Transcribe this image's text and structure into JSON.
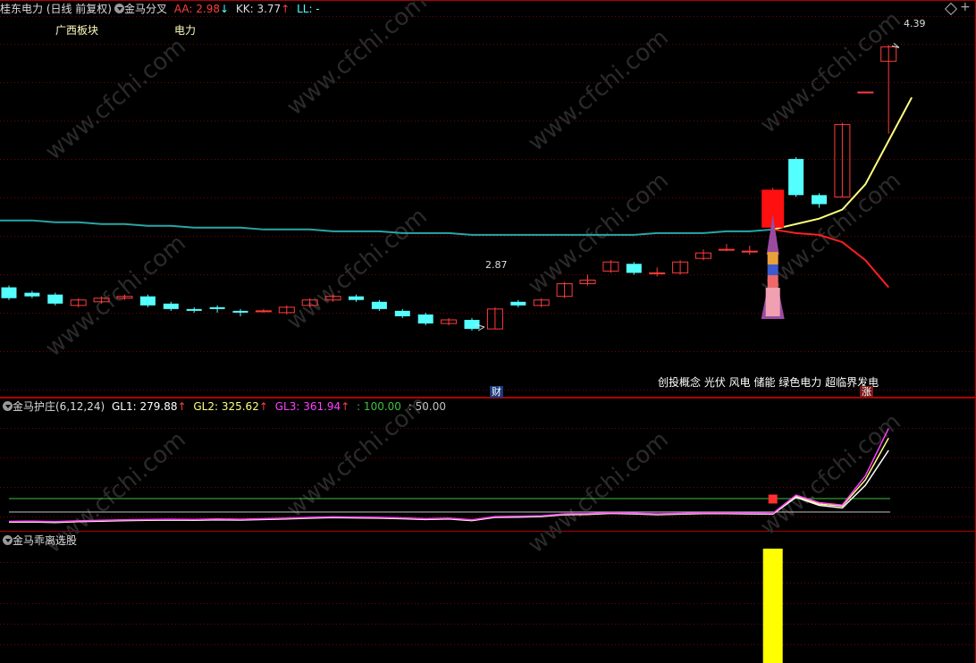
{
  "header": {
    "stock_title": "桂东电力 (日线 前复权)",
    "indicator_name": "金马分叉",
    "aa_label": "AA: 2.98",
    "aa_arrow": "↓",
    "kk_label": "KK: 3.77",
    "kk_arrow": "↑",
    "ll_label": "LL: -"
  },
  "sector_tags": [
    "广西板块",
    "电力"
  ],
  "main_chart": {
    "high_label": "4.39",
    "low_label": "2.87",
    "concepts_text": "创投概念 光伏 风电 储能 绿色电力 超临界发电",
    "fin_badge": "财",
    "zhang_badge": "涨"
  },
  "panel2": {
    "title": "金马护庄(6,12,24)",
    "gl1_label": "GL1: 279.88",
    "gl1_arrow": "↑",
    "gl2_label": "GL2: 325.62",
    "gl2_arrow": "↑",
    "gl3_label": "GL3: 361.94",
    "gl3_arrow": "↑",
    "ref1_label": ": 100.00",
    "ref2_label": ": 50.00"
  },
  "panel3": {
    "title": "金马乖离选股"
  },
  "watermark": "www.cfchi.com",
  "colors": {
    "background": "#000000",
    "grid": "#7a0000",
    "up": "#ff3c3c",
    "down": "#54ffff",
    "ma_long": "#2aa6a6",
    "line_yellow": "#ffff80",
    "line_red": "#ff2020",
    "gl1": "#ffffff",
    "gl2": "#ffff80",
    "gl3": "#ff40ff",
    "ref100": "#40c040",
    "ref50": "#c0c0c0",
    "bar_yellow": "#ffff00"
  },
  "chart_data": [
    {
      "type": "candlestick",
      "title": "桂东电力 (日线 前复权)",
      "candles": [
        {
          "o": 3.05,
          "c": 2.99,
          "h": 3.06,
          "l": 2.98
        },
        {
          "o": 3.02,
          "c": 3.0,
          "h": 3.03,
          "l": 2.99
        },
        {
          "o": 3.01,
          "c": 2.96,
          "h": 3.02,
          "l": 2.95
        },
        {
          "o": 2.95,
          "c": 2.98,
          "h": 2.99,
          "l": 2.94
        },
        {
          "o": 2.97,
          "c": 2.99,
          "h": 3.0,
          "l": 2.96
        },
        {
          "o": 2.99,
          "c": 3.0,
          "h": 3.01,
          "l": 2.98
        },
        {
          "o": 3.0,
          "c": 2.95,
          "h": 3.01,
          "l": 2.94
        },
        {
          "o": 2.96,
          "c": 2.93,
          "h": 2.97,
          "l": 2.92
        },
        {
          "o": 2.93,
          "c": 2.92,
          "h": 2.94,
          "l": 2.91
        },
        {
          "o": 2.94,
          "c": 2.93,
          "h": 2.95,
          "l": 2.91
        },
        {
          "o": 2.92,
          "c": 2.91,
          "h": 2.93,
          "l": 2.89
        },
        {
          "o": 2.92,
          "c": 2.92,
          "h": 2.93,
          "l": 2.91
        },
        {
          "o": 2.91,
          "c": 2.94,
          "h": 2.95,
          "l": 2.9
        },
        {
          "o": 2.95,
          "c": 2.98,
          "h": 2.99,
          "l": 2.94
        },
        {
          "o": 2.98,
          "c": 3.0,
          "h": 3.01,
          "l": 2.97
        },
        {
          "o": 3.0,
          "c": 2.98,
          "h": 3.01,
          "l": 2.97
        },
        {
          "o": 2.97,
          "c": 2.93,
          "h": 2.98,
          "l": 2.92
        },
        {
          "o": 2.92,
          "c": 2.89,
          "h": 2.93,
          "l": 2.88
        },
        {
          "o": 2.9,
          "c": 2.85,
          "h": 2.91,
          "l": 2.84
        },
        {
          "o": 2.85,
          "c": 2.87,
          "h": 2.88,
          "l": 2.84
        },
        {
          "o": 2.87,
          "c": 2.82,
          "h": 2.88,
          "l": 2.81
        },
        {
          "o": 2.82,
          "c": 2.93,
          "h": 2.94,
          "l": 2.82
        },
        {
          "o": 2.97,
          "c": 2.95,
          "h": 2.98,
          "l": 2.94
        },
        {
          "o": 2.95,
          "c": 2.98,
          "h": 2.99,
          "l": 2.94
        },
        {
          "o": 3.0,
          "c": 3.07,
          "h": 3.08,
          "l": 2.99
        },
        {
          "o": 3.07,
          "c": 3.09,
          "h": 3.12,
          "l": 3.06
        },
        {
          "o": 3.14,
          "c": 3.19,
          "h": 3.2,
          "l": 3.13
        },
        {
          "o": 3.18,
          "c": 3.13,
          "h": 3.19,
          "l": 3.12
        },
        {
          "o": 3.13,
          "c": 3.13,
          "h": 3.16,
          "l": 3.11
        },
        {
          "o": 3.13,
          "c": 3.19,
          "h": 3.2,
          "l": 3.12
        },
        {
          "o": 3.21,
          "c": 3.24,
          "h": 3.26,
          "l": 3.2
        },
        {
          "o": 3.26,
          "c": 3.26,
          "h": 3.29,
          "l": 3.25
        },
        {
          "o": 3.25,
          "c": 3.25,
          "h": 3.28,
          "l": 3.23
        },
        {
          "o": 3.38,
          "c": 3.59,
          "h": 3.6,
          "l": 3.38
        },
        {
          "o": 3.76,
          "c": 3.56,
          "h": 3.77,
          "l": 3.55
        },
        {
          "o": 3.56,
          "c": 3.51,
          "h": 3.57,
          "l": 3.49
        },
        {
          "o": 3.55,
          "c": 3.95,
          "h": 3.96,
          "l": 3.55
        },
        {
          "o": 4.13,
          "c": 4.13,
          "h": 4.13,
          "l": 4.13
        },
        {
          "o": 4.3,
          "c": 4.38,
          "h": 4.39,
          "l": 3.9
        }
      ],
      "ma_long": [
        3.42,
        3.42,
        3.41,
        3.41,
        3.4,
        3.4,
        3.39,
        3.39,
        3.38,
        3.38,
        3.38,
        3.37,
        3.37,
        3.37,
        3.36,
        3.36,
        3.36,
        3.35,
        3.35,
        3.35,
        3.34,
        3.34,
        3.34,
        3.34,
        3.34,
        3.34,
        3.34,
        3.34,
        3.35,
        3.35,
        3.35,
        3.36,
        3.36,
        3.37
      ],
      "yellow_line": {
        "start_index": 33,
        "values": [
          3.37,
          3.4,
          3.43,
          3.48,
          3.62,
          3.86,
          4.1
        ]
      },
      "red_line": {
        "start_index": 33,
        "values": [
          3.37,
          3.35,
          3.34,
          3.3,
          3.2,
          3.05
        ]
      },
      "annotations": {
        "high": 4.39,
        "low": 2.87
      }
    },
    {
      "type": "line",
      "title": "金马护庄(6,12,24)",
      "series": [
        {
          "name": "GL1",
          "values": [
            12,
            13,
            11,
            14,
            16,
            18,
            19,
            20,
            19,
            21,
            20,
            22,
            24,
            27,
            29,
            28,
            27,
            25,
            22,
            24,
            18,
            30,
            31,
            33,
            40,
            41,
            45,
            43,
            40,
            42,
            44,
            44,
            43,
            42,
            105,
            75,
            65,
            150,
            280
          ]
        },
        {
          "name": "GL2",
          "values": [
            14,
            15,
            13,
            16,
            18,
            20,
            21,
            22,
            21,
            23,
            22,
            24,
            26,
            29,
            31,
            30,
            29,
            27,
            24,
            26,
            20,
            32,
            33,
            35,
            42,
            43,
            47,
            45,
            42,
            44,
            46,
            46,
            45,
            44,
            110,
            80,
            72,
            170,
            326
          ]
        },
        {
          "name": "GL3",
          "values": [
            15,
            16,
            14,
            17,
            19,
            21,
            22,
            23,
            22,
            24,
            23,
            25,
            27,
            30,
            32,
            31,
            30,
            28,
            25,
            27,
            21,
            33,
            34,
            36,
            43,
            44,
            48,
            46,
            43,
            45,
            47,
            47,
            46,
            45,
            113,
            85,
            76,
            185,
            362
          ]
        }
      ],
      "reference_lines": [
        100,
        50
      ],
      "ylim": [
        0,
        420
      ]
    },
    {
      "type": "bar",
      "title": "金马乖离选股",
      "bars": [
        {
          "index": 33,
          "value": 1
        }
      ]
    }
  ]
}
